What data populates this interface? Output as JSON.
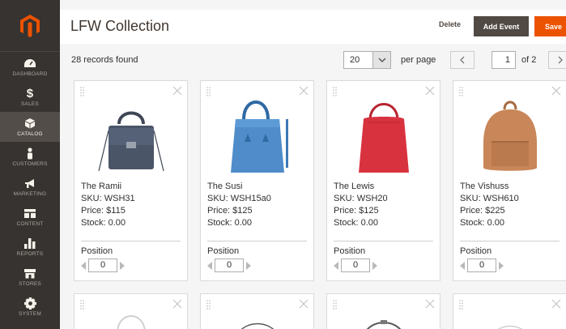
{
  "nav": {
    "items": [
      {
        "label": "Dashboard",
        "icon": "dashboard-icon",
        "active": false
      },
      {
        "label": "Sales",
        "icon": "dollar-icon",
        "active": false
      },
      {
        "label": "Catalog",
        "icon": "cube-icon",
        "active": true
      },
      {
        "label": "Customers",
        "icon": "person-icon",
        "active": false
      },
      {
        "label": "Marketing",
        "icon": "megaphone-icon",
        "active": false
      },
      {
        "label": "Content",
        "icon": "content-icon",
        "active": false
      },
      {
        "label": "Reports",
        "icon": "bar-chart-icon",
        "active": false
      },
      {
        "label": "Stores",
        "icon": "store-icon",
        "active": false
      },
      {
        "label": "System",
        "icon": "gear-icon",
        "active": false
      }
    ],
    "sales_symbol": "$"
  },
  "header": {
    "title": "LFW Collection",
    "delete_label": "Delete",
    "add_event_label": "Add Event",
    "save_label": "Save"
  },
  "toolbar": {
    "records_found": "28 records found",
    "per_page_value": "20",
    "per_page_label": "per page",
    "page_current": "1",
    "page_total": "of 2"
  },
  "products": [
    {
      "name": "The Ramii",
      "sku": "SKU: WSH31",
      "price": "Price: $115",
      "stock": "Stock: 0.00",
      "position_label": "Position",
      "position": "0",
      "color": "#4a5567"
    },
    {
      "name": "The Susi",
      "sku": "SKU: WSH15a0",
      "price": "Price: $125",
      "stock": "Stock: 0.00",
      "position_label": "Position",
      "position": "0",
      "color": "#4f8cc9"
    },
    {
      "name": "The Lewis",
      "sku": "SKU: WSH20",
      "price": "Price: $125",
      "stock": "Stock: 0.00",
      "position_label": "Position",
      "position": "0",
      "color": "#d8323e"
    },
    {
      "name": "The Vishuss",
      "sku": "SKU: WSH610",
      "price": "Price: $225",
      "stock": "Stock: 0.00",
      "position_label": "Position",
      "position": "0",
      "color": "#c98658"
    }
  ],
  "colors": {
    "sidebar": "#373330",
    "accent": "#eb5202",
    "dark_button": "#514943"
  }
}
